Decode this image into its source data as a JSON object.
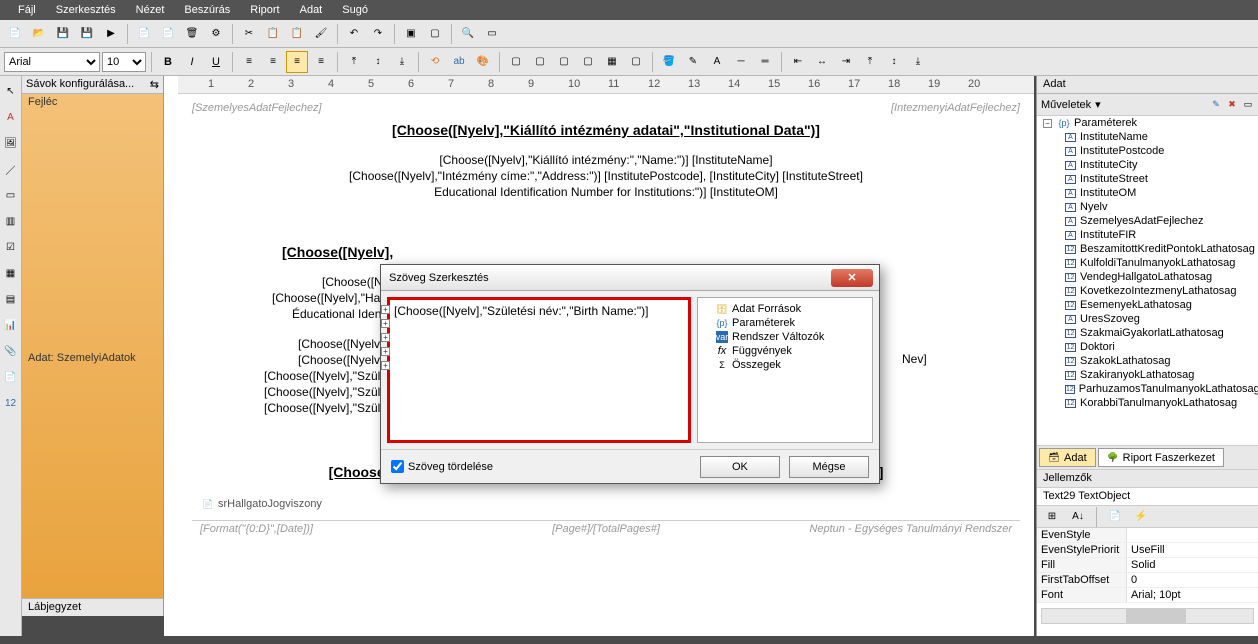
{
  "menu": [
    "Fájl",
    "Szerkesztés",
    "Nézet",
    "Beszúrás",
    "Riport",
    "Adat",
    "Sugó"
  ],
  "font": {
    "family": "Arial",
    "size": "10"
  },
  "reportTree": {
    "head": "Sávok konfigurálása...",
    "items": [
      "Fejléc",
      "Adat: SzemelyiAdatok",
      "Lábjegyzet"
    ]
  },
  "ruler": [
    "1",
    "2",
    "3",
    "4",
    "5",
    "6",
    "7",
    "8",
    "9",
    "10",
    "11",
    "12",
    "13",
    "14",
    "15",
    "16",
    "17",
    "18",
    "19",
    "20"
  ],
  "doc": {
    "topPlaceholders": [
      "[SzemelyesAdatFejlechez]",
      "[IntezmenyiAdatFejlechez]"
    ],
    "h1": "[Choose([Nyelv],\"Kiállító intézmény adatai\",\"Institutional Data\")]",
    "lines1": [
      "[Choose([Nyelv],\"Kiállító intézmény:\",\"Name:\")]  [InstituteName]",
      "[Choose([Nyelv],\"Intézmény címe:\",\"Address:\")]  [InstitutePostcode], [InstituteCity] [InstituteStreet]",
      "Educational Identification Number for Institutions:\")]  [InstituteOM]"
    ],
    "h2cut": "[Choose([Nyelv],",
    "lines2": [
      "[Choose([Nye",
      "[Choose([Nyelv],\"Hallgat",
      "Éducational Identific"
    ],
    "lines3": [
      "[Choose([Nyelv],",
      "[Choose([Nyelv],",
      "[Choose([Nyelv],\"Szüle",
      "[Choose([Nyelv],\"Szüle",
      "[Choose([Nyelv],\"Szüle"
    ],
    "rightFrag": "Nev]",
    "h3": "[Choose([Nyelv],\"Hallgatói jogviszonyra vonatkozó adatok\",\"Student Status Data\")]",
    "sub": "srHallgatoJogviszony",
    "footL": "[Format(\"{0:D}\",[Date])]",
    "footM": "[Page#]/[TotalPages#]",
    "footR": "Neptun - Egységes Tanulmányi Rendszer"
  },
  "dialog": {
    "title": "Szöveg Szerkesztés",
    "text": "[Choose([Nyelv],\"Születési név:\",\"Birth Name:\")]",
    "tree": [
      "Adat Források",
      "Paraméterek",
      "Rendszer Változók",
      "Függvények",
      "Összegek"
    ],
    "wrap": "Szöveg tördelése",
    "ok": "OK",
    "cancel": "Mégse"
  },
  "right": {
    "title": "Adat",
    "ops": "Műveletek",
    "root": "Paraméterek",
    "params": [
      "InstituteName",
      "InstitutePostcode",
      "InstituteCity",
      "InstituteStreet",
      "InstituteOM",
      "Nyelv",
      "SzemelyesAdatFejlechez",
      "InstituteFIR",
      "BeszamitottKreditPontokLathatosag",
      "KulfoldiTanulmanyokLathatosag",
      "VendegHallgatoLathatosag",
      "KovetkezoIntezmenyLathatosag",
      "EsemenyekLathatosag",
      "UresSzoveg",
      "SzakmaiGyakorlatLathatosag",
      "Doktori",
      "SzakokLathatosag",
      "SzakiranyokLathatosag",
      "ParhuzamosTanulmanyokLathatosag",
      "KorabbiTanulmanyokLathatosag"
    ],
    "tabs": [
      "Adat",
      "Riport Faszerkezet"
    ],
    "sec": "Jellemzők",
    "obj": "Text29  TextObject",
    "props": [
      {
        "k": "EvenStyle",
        "v": ""
      },
      {
        "k": "EvenStylePriorit",
        "v": "UseFill"
      },
      {
        "k": "Fill",
        "v": "Solid"
      },
      {
        "k": "FirstTabOffset",
        "v": "0"
      },
      {
        "k": "Font",
        "v": "Arial; 10pt"
      }
    ]
  }
}
